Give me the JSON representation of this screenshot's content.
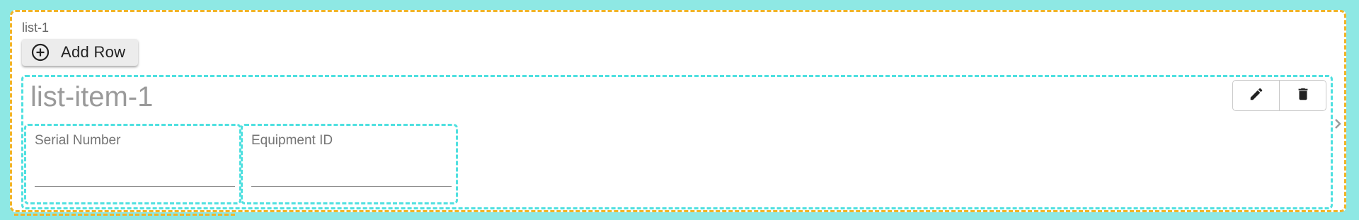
{
  "list": {
    "title": "list-1",
    "add_row_label": "Add Row",
    "add_row_icon": "plus-circle-icon"
  },
  "list_item": {
    "title": "list-item-1",
    "actions": [
      {
        "icon": "pencil-icon",
        "name": "edit"
      },
      {
        "icon": "trash-icon",
        "name": "delete"
      }
    ],
    "fields": [
      {
        "label": "Serial Number",
        "value": "",
        "placeholder": ""
      },
      {
        "label": "Equipment ID",
        "value": "",
        "placeholder": ""
      }
    ]
  },
  "colors": {
    "page_background": "#8ee8e4",
    "list_border": "#f0b428",
    "item_border": "#4fe0e0",
    "button_background": "#ececec"
  }
}
